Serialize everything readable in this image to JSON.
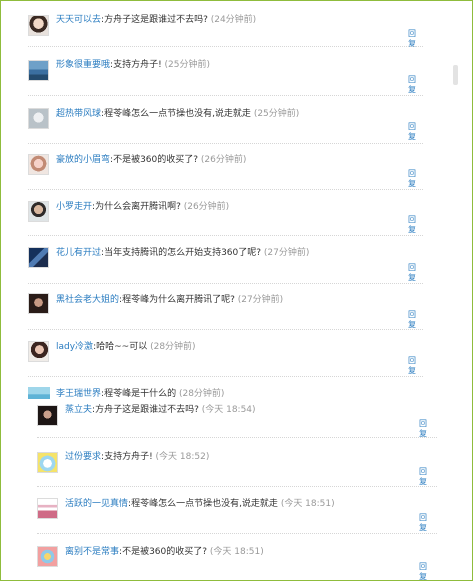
{
  "reply_label": "回复",
  "comments": [
    {
      "user": "天天可以去",
      "text": "方舟子这是跟谁过不去吗?",
      "time": "(24分钟前)",
      "avatar": "avatar-woman-portrait-icon"
    },
    {
      "user": "形象很重要哦",
      "text": "支持方舟子!",
      "time": "(25分钟前)",
      "avatar": "avatar-landscape-icon"
    },
    {
      "user": "超热带风球",
      "text": "程苓峰怎么一点节操也没有,说走就走",
      "time": "(25分钟前)",
      "avatar": "avatar-pale-portrait-icon"
    },
    {
      "user": "豪放的小眉弯",
      "text": "不是被360的收买了?",
      "time": "(26分钟前)",
      "avatar": "avatar-doll-icon"
    },
    {
      "user": "小罗走开",
      "text": "为什么会离开腾讯啊?",
      "time": "(26分钟前)",
      "avatar": "avatar-man-portrait-icon"
    },
    {
      "user": "花儿有开过",
      "text": "当年支持腾讯的怎么开始支持360了呢?",
      "time": "(27分钟前)",
      "avatar": "avatar-dark-blue-icon"
    },
    {
      "user": "黑社会老大姐的",
      "text": "程苓峰为什么离开腾讯了呢?",
      "time": "(27分钟前)",
      "avatar": "avatar-dark-portrait-icon"
    },
    {
      "user": "lady冷激",
      "text": "哈哈~~可以",
      "time": "(28分钟前)",
      "avatar": "avatar-lady-portrait-icon"
    },
    {
      "user": "李王瑞世界",
      "text": "程苓峰是干什么的",
      "time": "(28分钟前)",
      "avatar": "avatar-sky-icon"
    },
    {
      "user": "蒸立夫",
      "text": "方舟子这是跟谁过不去吗?",
      "time": "(今天 18:54)",
      "avatar": "avatar-girl-dark-icon"
    },
    {
      "user": "过份要求",
      "text": "支持方舟子!",
      "time": "(今天 18:52)",
      "avatar": "avatar-cartoon-icon"
    },
    {
      "user": "活跃的一见真情",
      "text": "程苓峰怎么一点节操也没有,说走就走",
      "time": "(今天 18:51)",
      "avatar": "avatar-stripes-icon"
    },
    {
      "user": "离别不是常事",
      "text": "不是被360的收买了?",
      "time": "(今天 18:51)",
      "avatar": "avatar-colorful-icon"
    }
  ]
}
